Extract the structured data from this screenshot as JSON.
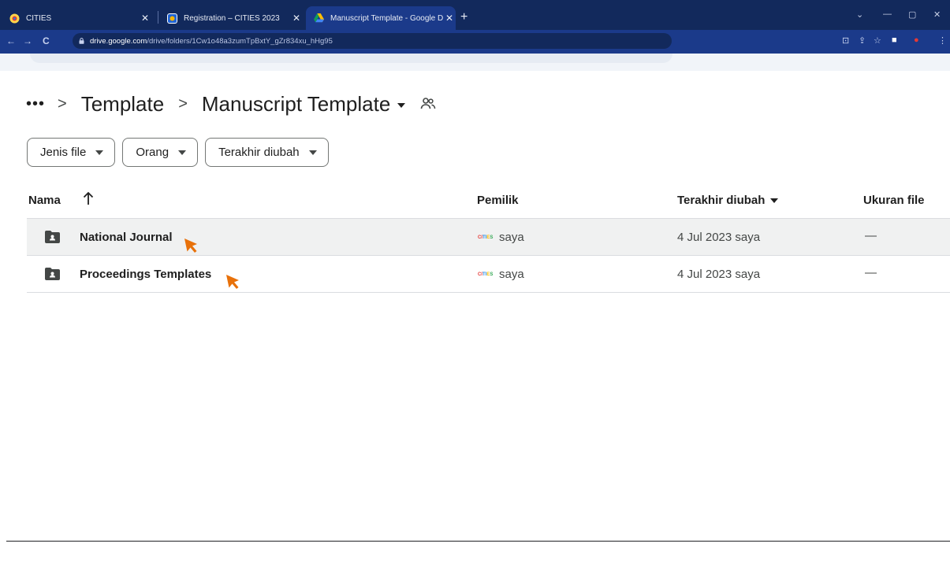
{
  "browser": {
    "tabs": [
      {
        "title": "CITIES",
        "active": false
      },
      {
        "title": "Registration – CITIES 2023",
        "active": false
      },
      {
        "title": "Manuscript Template - Google D",
        "active": true
      }
    ],
    "new_tab": "+",
    "url_host": "drive.google.com",
    "url_path": "/drive/folders/1Cw1o48a3zumTpBxtY_gZr834xu_hHg95"
  },
  "breadcrumb": {
    "more": "•••",
    "separator": ">",
    "parent": "Template",
    "current": "Manuscript Template"
  },
  "filters": {
    "file_type": "Jenis file",
    "people": "Orang",
    "modified": "Terakhir diubah"
  },
  "table": {
    "headers": {
      "name": "Nama",
      "owner": "Pemilik",
      "modified": "Terakhir diubah",
      "size": "Ukuran file"
    },
    "rows": [
      {
        "name": "National Journal",
        "owner_logo": "CITIES",
        "owner": "saya",
        "modified": "4 Jul 2023 saya",
        "size": "—"
      },
      {
        "name": "Proceedings Templates",
        "owner_logo": "CITIES",
        "owner": "saya",
        "modified": "4 Jul 2023 saya",
        "size": "—"
      }
    ]
  },
  "colors": {
    "tabbar": "#12295c",
    "toolbar": "#1b3a8a",
    "row_hover": "#f0f1f1",
    "cursor": "#e8710a"
  }
}
